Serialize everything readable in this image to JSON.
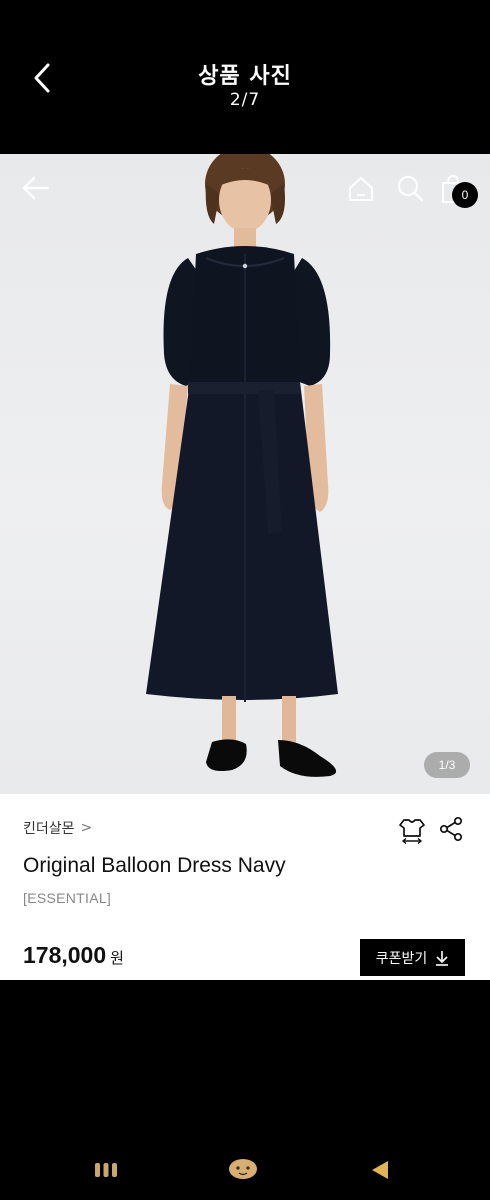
{
  "viewer": {
    "title": "상품 사진",
    "counter": "2/7",
    "back_icon": "chevron-left-icon"
  },
  "product_page": {
    "cart_count": "0",
    "image_pager": "1/3",
    "brand": "킨더살몬",
    "brand_chevron": ">",
    "product_name": "Original Balloon Dress Navy",
    "collection": "[ESSENTIAL]",
    "price": "178,000",
    "currency": "원",
    "coupon_label": "쿠폰받기",
    "icons": [
      "arrow-left-icon",
      "home-icon",
      "search-icon",
      "shopping-bag-icon",
      "size-guide-icon",
      "share-icon",
      "download-icon"
    ]
  },
  "system_nav": {
    "icons": [
      "recent-apps-icon",
      "home-icon",
      "back-icon"
    ],
    "colors": {
      "recent": "#c9a86a",
      "home": "#d8ae72",
      "back": "#e0b456"
    }
  }
}
